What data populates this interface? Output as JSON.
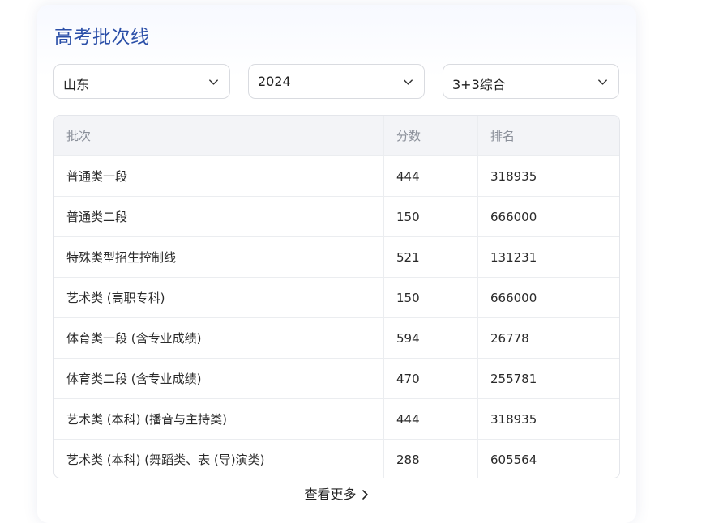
{
  "page": {
    "title": "高考批次线"
  },
  "filters": {
    "province": "山东",
    "year": "2024",
    "subject": "3+3综合"
  },
  "table": {
    "headers": [
      "批次",
      "分数",
      "排名"
    ],
    "rows": [
      [
        "普通类一段",
        "444",
        "318935"
      ],
      [
        "普通类二段",
        "150",
        "666000"
      ],
      [
        "特殊类型招生控制线",
        "521",
        "131231"
      ],
      [
        "艺术类 (高职专科)",
        "150",
        "666000"
      ],
      [
        "体育类一段 (含专业成绩)",
        "594",
        "26778"
      ],
      [
        "体育类二段 (含专业成绩)",
        "470",
        "255781"
      ],
      [
        "艺术类 (本科) (播音与主持类)",
        "444",
        "318935"
      ],
      [
        "艺术类 (本科) (舞蹈类、表 (导)演类)",
        "288",
        "605564"
      ]
    ]
  },
  "more": {
    "label": "查看更多"
  },
  "colors": {
    "title": "#2b4fa8",
    "header_bg": "#f3f4f7",
    "border": "#d9dbe0"
  },
  "icons": {
    "select_chevron": "chevron-down-icon",
    "more_chevron": "chevron-right-icon"
  }
}
